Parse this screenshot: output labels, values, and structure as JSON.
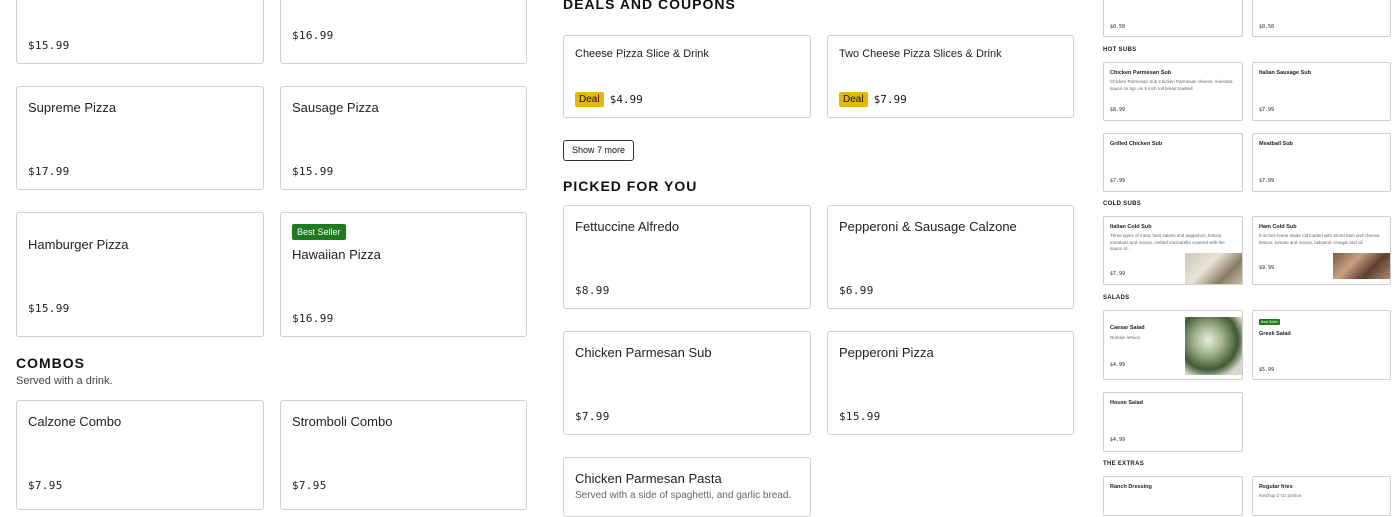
{
  "left_items": [
    {
      "name": "",
      "price": "$15.99"
    },
    {
      "name": "",
      "price": "$16.99"
    },
    {
      "name": "Supreme Pizza",
      "price": "$17.99"
    },
    {
      "name": "Sausage Pizza",
      "price": "$15.99"
    },
    {
      "name": "Hamburger Pizza",
      "price": "$15.99"
    },
    {
      "name": "Hawaiian Pizza",
      "price": "$16.99",
      "badge": "Best Seller"
    }
  ],
  "combos": {
    "title": "COMBOS",
    "subtitle": "Served with a drink.",
    "items": [
      {
        "name": "Calzone Combo",
        "price": "$7.95"
      },
      {
        "name": "Stromboli Combo",
        "price": "$7.95"
      }
    ]
  },
  "deals": {
    "title": "DEALS AND COUPONS",
    "deal_label": "Deal",
    "items": [
      {
        "name": "Cheese Pizza Slice & Drink",
        "price": "$4.99"
      },
      {
        "name": "Two Cheese Pizza Slices & Drink",
        "price": "$7.99"
      }
    ],
    "show_more": "Show 7 more"
  },
  "picked": {
    "title": "PICKED FOR YOU",
    "items": [
      {
        "name": "Fettuccine Alfredo",
        "price": "$8.99"
      },
      {
        "name": "Pepperoni & Sausage Calzone",
        "price": "$6.99"
      },
      {
        "name": "Chicken Parmesan Sub",
        "price": "$7.99"
      },
      {
        "name": "Pepperoni Pizza",
        "price": "$15.99"
      },
      {
        "name": "Chicken Parmesan Pasta",
        "desc": "Served with a side of spaghetti, and garlic bread."
      }
    ]
  },
  "right": {
    "top_prices": [
      "$0.50",
      "$0.50"
    ],
    "hot_subs": {
      "title": "HOT SUBS",
      "items": [
        {
          "name": "Chicken Parmesan Sub",
          "desc": "Chicken Parmesan Sub Chicken Parmesan cheese, marinara sauce on top, on 9 inch roll bread toasted.",
          "price": "$8.99"
        },
        {
          "name": "Italian Sausage Sub",
          "price": "$7.99"
        },
        {
          "name": "Grilled Chicken Sub",
          "price": "$7.99"
        },
        {
          "name": "Meatball Sub",
          "price": "$7.99"
        }
      ]
    },
    "cold_subs": {
      "title": "COLD SUBS",
      "items": [
        {
          "name": "Italian Cold Sub",
          "desc": "Three types of meat; ham,salami and pepperoni, lettuce, tomatoes and onions, melted mozzarella covered with the sauce of...",
          "price": "$7.99"
        },
        {
          "name": "Ham Cold Sub",
          "desc": "8 inches home made roll loaded with sliced ham and cheese, lettuce, tomato and onions, balsamic vinegar and oil.",
          "price": "$9.99"
        }
      ]
    },
    "salads": {
      "title": "SALADS",
      "items": [
        {
          "name": "Caesar Salad",
          "desc": "Romain lettuce",
          "price": "$4.99"
        },
        {
          "name": "Greek Salad",
          "price": "$5.99",
          "badge": "Best Seller"
        },
        {
          "name": "House Salad",
          "price": "$4.99"
        }
      ]
    },
    "extras": {
      "title": "THE EXTRAS",
      "items": [
        {
          "name": "Ranch Dressing"
        },
        {
          "name": "Regular fries",
          "desc": "Ketchup 2 Oz portion"
        }
      ]
    }
  },
  "colors": {
    "best_seller": "#1f7a1f",
    "deal_badge": "#e6b800",
    "border": "#d0d0d0"
  }
}
